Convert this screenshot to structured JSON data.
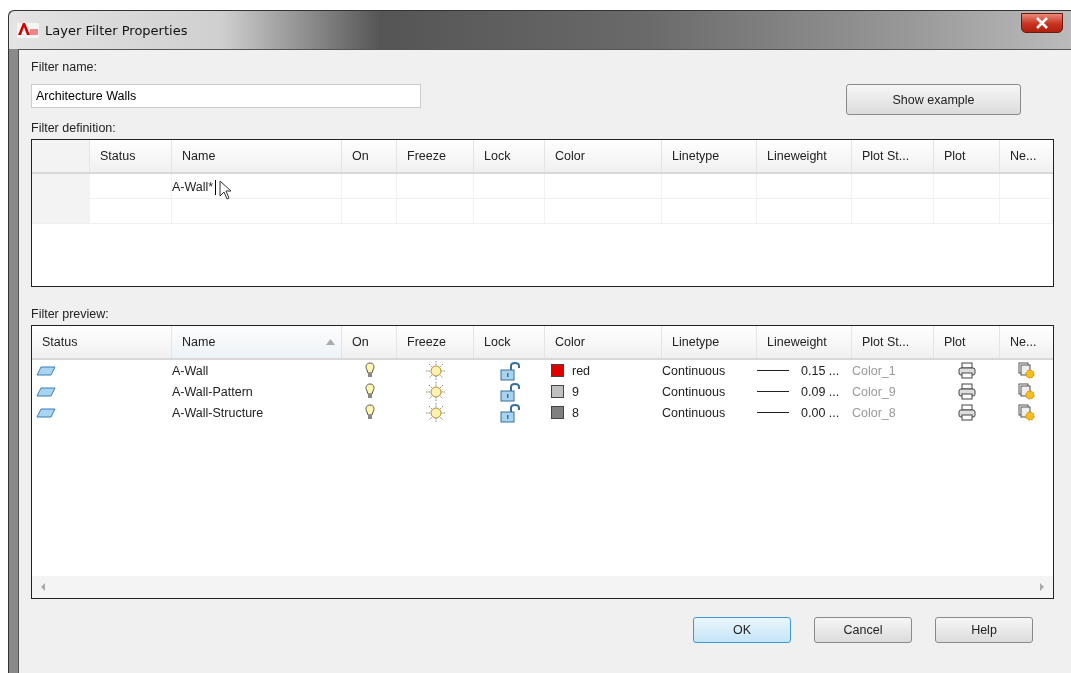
{
  "window": {
    "title": "Layer Filter Properties"
  },
  "filter_name": {
    "label": "Filter name:",
    "value": "Architecture Walls"
  },
  "show_example_button": "Show example",
  "filter_definition": {
    "label": "Filter definition:",
    "columns": [
      "Status",
      "Name",
      "On",
      "Freeze",
      "Lock",
      "Color",
      "Linetype",
      "Lineweight",
      "Plot St...",
      "Plot",
      "Ne..."
    ],
    "rows": [
      {
        "name": "A-Wall*",
        "editing": true
      }
    ]
  },
  "filter_preview": {
    "label": "Filter preview:",
    "columns": [
      {
        "label": "Status",
        "sorted": false
      },
      {
        "label": "Name",
        "sorted": true
      },
      {
        "label": "On",
        "sorted": false
      },
      {
        "label": "Freeze",
        "sorted": false
      },
      {
        "label": "Lock",
        "sorted": false
      },
      {
        "label": "Color",
        "sorted": false
      },
      {
        "label": "Linetype",
        "sorted": false
      },
      {
        "label": "Lineweight",
        "sorted": false
      },
      {
        "label": "Plot St...",
        "sorted": false
      },
      {
        "label": "Plot",
        "sorted": false
      },
      {
        "label": "Ne...",
        "sorted": false
      }
    ],
    "rows": [
      {
        "name": "A-Wall",
        "on": true,
        "frozen": false,
        "locked": false,
        "color_label": "red",
        "color": "#e00000",
        "linetype": "Continuous",
        "lineweight": "0.15 ...",
        "plot_style": "Color_1",
        "plot": true
      },
      {
        "name": "A-Wall-Pattern",
        "on": true,
        "frozen": false,
        "locked": false,
        "color_label": "9",
        "color": "#c0c0c0",
        "linetype": "Continuous",
        "lineweight": "0.09 ...",
        "plot_style": "Color_9",
        "plot": true
      },
      {
        "name": "A-Wall-Structure",
        "on": true,
        "frozen": false,
        "locked": false,
        "color_label": "8",
        "color": "#808080",
        "linetype": "Continuous",
        "lineweight": "0.00 ...",
        "plot_style": "Color_8",
        "plot": true
      }
    ]
  },
  "buttons": [
    {
      "label": "OK",
      "default": true
    },
    {
      "label": "Cancel",
      "default": false
    },
    {
      "label": "Help",
      "default": false
    }
  ]
}
